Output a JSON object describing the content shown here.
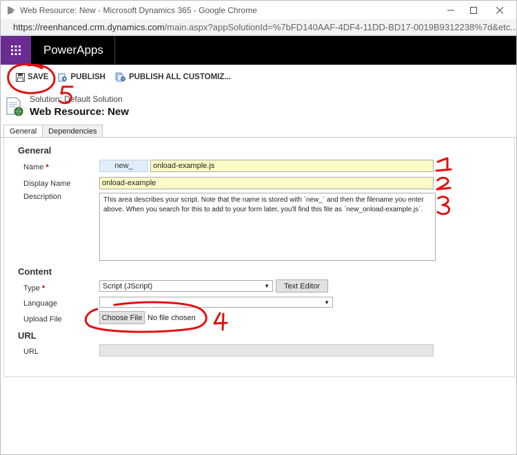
{
  "window": {
    "title": "Web Resource: New - Microsoft Dynamics 365 - Google Chrome",
    "minimize_icon": "minimize-icon",
    "maximize_icon": "maximize-icon",
    "close_icon": "close-icon"
  },
  "address": {
    "url_host": "https://reenhanced.crm.dynamics.com",
    "url_path": "/main.aspx?appSolutionId=%7bFD140AAF-4DF4-11DD-BD17-0019B9312238%7d&etc..."
  },
  "nav": {
    "brand": "PowerApps",
    "waffle_icon": "app-launcher-icon",
    "waffle_color": "#6b2c91"
  },
  "commands": {
    "save": "SAVE",
    "publish": "PUBLISH",
    "publish_all": "PUBLISH ALL CUSTOMIZ..."
  },
  "header": {
    "solution": "Solution: Default Solution",
    "title": "Web Resource: New"
  },
  "tabs": [
    {
      "label": "General",
      "active": true
    },
    {
      "label": "Dependencies",
      "active": false
    }
  ],
  "general": {
    "section": "General",
    "name_label": "Name",
    "required_marker": "*",
    "name_prefix": "new_",
    "name_value": "onload-example.js",
    "display_name_label": "Display Name",
    "display_name_value": "onload-example",
    "description_label": "Description",
    "description_value": "This area describes your script. Note that the name is stored with `new_` and then the filename you enter above. When you search for this to add to your form later, you'll find this file as `new_onload-example.js`."
  },
  "content": {
    "section": "Content",
    "type_label": "Type",
    "type_value": "Script (JScript)",
    "text_editor_button": "Text Editor",
    "language_label": "Language",
    "language_value": "",
    "upload_label": "Upload File",
    "choose_file_button": "Choose File",
    "no_file_text": "No file chosen"
  },
  "url_section": {
    "section": "URL",
    "url_label": "URL",
    "url_value": ""
  },
  "annotations": {
    "color": "#e21010",
    "marks": [
      "1",
      "2",
      "3",
      "4",
      "5"
    ]
  },
  "colors": {
    "field_highlight": "#fbfcc5",
    "prefix_bg": "#e0ecf8"
  }
}
